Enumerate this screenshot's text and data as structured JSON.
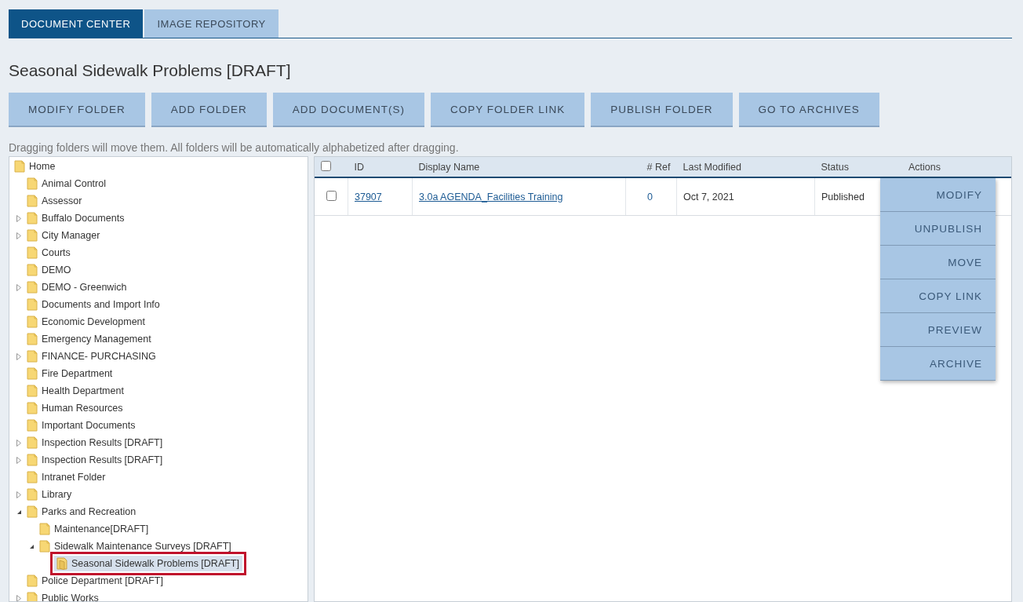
{
  "tabs": [
    {
      "label": "DOCUMENT CENTER",
      "selected": true
    },
    {
      "label": "IMAGE REPOSITORY",
      "selected": false
    }
  ],
  "title": "Seasonal Sidewalk Problems [DRAFT]",
  "toolbar_buttons": [
    "MODIFY FOLDER",
    "ADD FOLDER",
    "ADD DOCUMENT(S)",
    "COPY FOLDER LINK",
    "PUBLISH FOLDER",
    "GO TO ARCHIVES"
  ],
  "hint": "Dragging folders will move them. All folders will be automatically alphabetized after dragging.",
  "tree": [
    {
      "label": "Home",
      "selected": false,
      "children": [
        {
          "label": "Animal Control",
          "selected": false
        },
        {
          "label": "Assessor",
          "selected": false
        },
        {
          "label": "Buffalo Documents",
          "expanded": false,
          "selected": false
        },
        {
          "label": "City Manager",
          "expanded": false,
          "selected": false
        },
        {
          "label": "Courts",
          "selected": false
        },
        {
          "label": "DEMO",
          "selected": false
        },
        {
          "label": "DEMO - Greenwich",
          "expanded": false,
          "selected": false
        },
        {
          "label": "Documents and Import Info",
          "selected": false
        },
        {
          "label": "Economic Development",
          "selected": false
        },
        {
          "label": "Emergency Management",
          "selected": false
        },
        {
          "label": "FINANCE- PURCHASING",
          "expanded": false,
          "selected": false
        },
        {
          "label": "Fire Department",
          "selected": false
        },
        {
          "label": "Health Department",
          "selected": false
        },
        {
          "label": "Human Resources",
          "selected": false
        },
        {
          "label": "Important Documents",
          "selected": false
        },
        {
          "label": "Inspection Results [DRAFT]",
          "expanded": false,
          "selected": false
        },
        {
          "label": "Inspection Results [DRAFT]",
          "expanded": false,
          "selected": false
        },
        {
          "label": "Intranet Folder",
          "selected": false
        },
        {
          "label": "Library",
          "expanded": false,
          "selected": false
        },
        {
          "label": "Parks and Recreation",
          "expanded": true,
          "selected": false,
          "children": [
            {
              "label": "Maintenance[DRAFT]",
              "selected": false
            },
            {
              "label": "Sidewalk Maintenance Surveys [DRAFT]",
              "expanded": true,
              "selected": false,
              "children": [
                {
                  "label": "Seasonal Sidewalk Problems [DRAFT]",
                  "selected": true
                }
              ]
            }
          ]
        },
        {
          "label": "Police Department [DRAFT]",
          "selected": false
        },
        {
          "label": "Public Works",
          "expanded": false,
          "selected": false
        }
      ]
    }
  ],
  "table": {
    "select_all_checked": false,
    "columns": [
      "ID",
      "Display Name",
      "# Ref",
      "Last Modified",
      "Status",
      "Actions"
    ],
    "rows": [
      {
        "checked": false,
        "id": "37907",
        "display_name": "3.0a AGENDA_Facilities Training",
        "ref": "0",
        "last_modified": "Oct 7, 2021",
        "status": "Published"
      }
    ]
  },
  "actions_menu": [
    "MODIFY",
    "UNPUBLISH",
    "MOVE",
    "COPY LINK",
    "PREVIEW",
    "ARCHIVE"
  ]
}
